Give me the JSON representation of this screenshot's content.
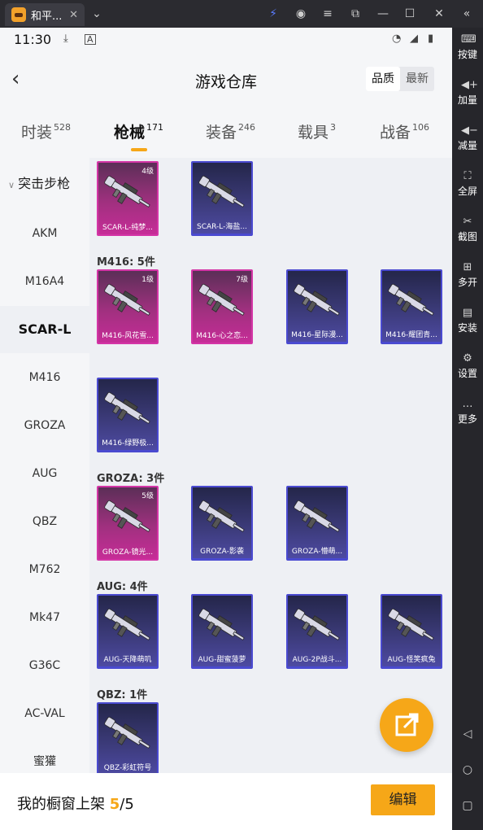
{
  "window": {
    "tab_title": "和平...",
    "tab_close": "✕",
    "menu_icon": "chevron-down-icon",
    "controls": {
      "lightning": "⚡",
      "account": "◉",
      "menu": "≡",
      "popout": "⧉",
      "minimize": "—",
      "maximize": "☐",
      "close": "✕",
      "collapse": "«"
    }
  },
  "right_sidebar": {
    "items": [
      {
        "label": "按键",
        "icon": "keyboard-icon"
      },
      {
        "label": "加量",
        "icon": "volume-up-icon"
      },
      {
        "label": "减量",
        "icon": "volume-down-icon"
      },
      {
        "label": "全屏",
        "icon": "fullscreen-icon"
      },
      {
        "label": "截图",
        "icon": "scissors-icon"
      },
      {
        "label": "多开",
        "icon": "multi-window-icon"
      },
      {
        "label": "安装",
        "icon": "apk-icon"
      },
      {
        "label": "设置",
        "icon": "gear-icon"
      },
      {
        "label": "更多",
        "icon": "more-icon"
      }
    ]
  },
  "status_bar": {
    "time": "11:30"
  },
  "header": {
    "title": "游戏仓库",
    "sort_options": [
      "品质",
      "最新"
    ],
    "sort_selected": "品质"
  },
  "category_tabs": [
    {
      "label": "时装",
      "count": "528"
    },
    {
      "label": "枪械",
      "count": "171",
      "active": true
    },
    {
      "label": "装备",
      "count": "246"
    },
    {
      "label": "载具",
      "count": "3"
    },
    {
      "label": "战备",
      "count": "106"
    }
  ],
  "left_list": {
    "group": "突击步枪",
    "items": [
      "AKM",
      "M16A4",
      "SCAR-L",
      "M416",
      "GROZA",
      "AUG",
      "QBZ",
      "M762",
      "Mk47",
      "G36C",
      "AC-VAL",
      "蜜獾"
    ],
    "selected": "SCAR-L"
  },
  "sections": [
    {
      "title": "",
      "items": [
        {
          "name": "SCAR-L-纯梦...",
          "level": "4级",
          "rarity": "pink"
        },
        {
          "name": "SCAR-L-海盐...",
          "level": "",
          "rarity": "blue"
        }
      ]
    },
    {
      "title": "M416: 5件",
      "items": [
        {
          "name": "M416-风花雪...",
          "level": "1级",
          "rarity": "pink"
        },
        {
          "name": "M416-心之恋...",
          "level": "7级",
          "rarity": "pink"
        },
        {
          "name": "M416-星际漫...",
          "level": "",
          "rarity": "blue"
        },
        {
          "name": "M416-耀团青...",
          "level": "",
          "rarity": "blue"
        },
        {
          "name": "M416-绿野极...",
          "level": "",
          "rarity": "blue"
        }
      ]
    },
    {
      "title": "GROZA: 3件",
      "items": [
        {
          "name": "GROZA-镜光...",
          "level": "5级",
          "rarity": "pink"
        },
        {
          "name": "GROZA-影袭",
          "level": "",
          "rarity": "blue"
        },
        {
          "name": "GROZA-懵萌...",
          "level": "",
          "rarity": "blue"
        }
      ]
    },
    {
      "title": "AUG: 4件",
      "items": [
        {
          "name": "AUG-天降萌叽",
          "level": "",
          "rarity": "blue"
        },
        {
          "name": "AUG-甜蜜菠萝",
          "level": "",
          "rarity": "blue"
        },
        {
          "name": "AUG-2P战斗...",
          "level": "",
          "rarity": "blue"
        },
        {
          "name": "AUG-怪笑疯兔",
          "level": "",
          "rarity": "blue"
        }
      ]
    },
    {
      "title": "QBZ: 1件",
      "items": [
        {
          "name": "QBZ-彩虹符号",
          "level": "",
          "rarity": "blue"
        }
      ]
    }
  ],
  "bottom_bar": {
    "label": "我的橱窗上架",
    "current": "5",
    "total": "/5",
    "edit_button": "编辑"
  },
  "colors": {
    "accent": "#f6a718",
    "pink_rarity": "#c62d97",
    "blue_rarity": "#4a4ad0"
  }
}
